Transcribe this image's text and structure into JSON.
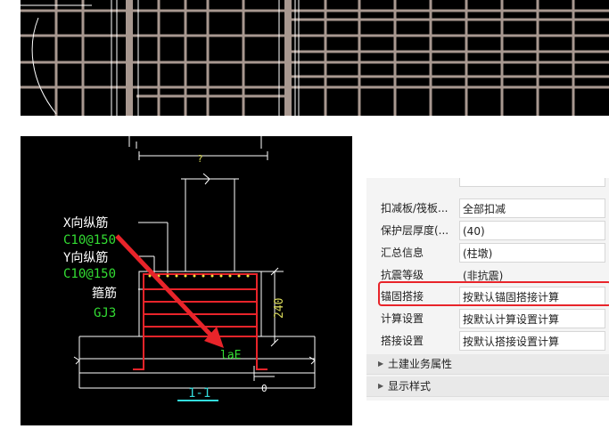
{
  "cad_section": {
    "labels": {
      "x_bar": "X向纵筋",
      "x_bar_spec": "C10@150",
      "y_bar": "Y向纵筋",
      "y_bar_spec": "C10@150",
      "stirrup": "箍筋",
      "stirrup_spec": "GJ3",
      "anchor_length": "laE",
      "height_dim": "240",
      "top_dim": "?",
      "cover_dim": "0",
      "section_name": "1-1"
    },
    "colors": {
      "background": "#000000",
      "outline": "#ffffff",
      "rebar": "#e8242a",
      "label_white": "#ffffff",
      "label_green": "#33dd33",
      "dimension": "#d9d95a",
      "section_title": "#33dddd",
      "arrow": "#e8242a"
    }
  },
  "properties": {
    "rows": [
      {
        "name": "扣减板/筏板...",
        "value": "全部扣减",
        "readonly": false
      },
      {
        "name": "保护层厚度(...",
        "value": "(40)",
        "readonly": false
      },
      {
        "name": "汇总信息",
        "value": "(柱墩)",
        "readonly": false
      },
      {
        "name": "抗震等级",
        "value": "(非抗震)",
        "readonly": true
      },
      {
        "name": "锚固搭接",
        "value": "按默认锚固搭接计算",
        "readonly": false
      },
      {
        "name": "计算设置",
        "value": "按默认计算设置计算",
        "readonly": false
      },
      {
        "name": "搭接设置",
        "value": "按默认搭接设置计算",
        "readonly": false
      }
    ],
    "sections": [
      {
        "label": "土建业务属性",
        "icon": "expand-triangle-icon"
      },
      {
        "label": "显示样式",
        "icon": "expand-triangle-icon"
      }
    ],
    "highlight_color": "#e8242a"
  }
}
